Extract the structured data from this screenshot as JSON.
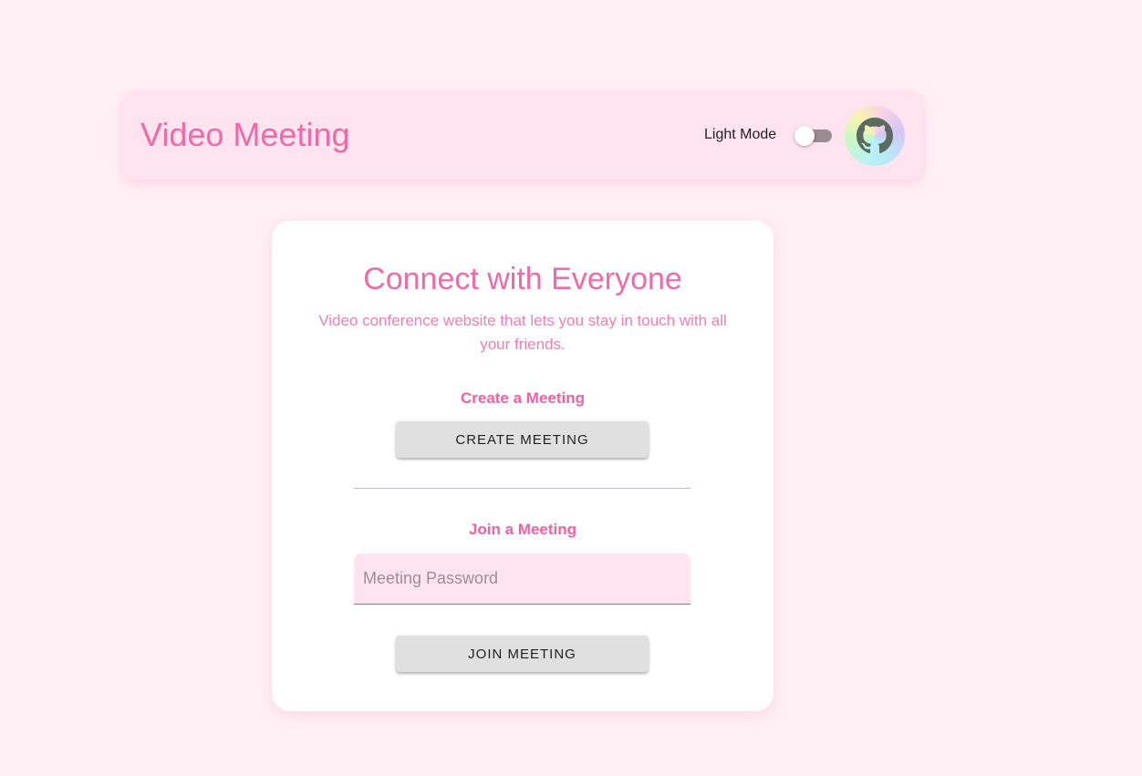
{
  "header": {
    "title": "Video Meeting",
    "mode_label": "Light Mode",
    "dark_mode_enabled": false,
    "github_icon": "github-icon"
  },
  "card": {
    "title": "Connect with Everyone",
    "subtitle": "Video conference website that lets you stay in touch with all your friends.",
    "create_heading": "Create a Meeting",
    "create_button": "CREATE MEETING",
    "join_heading": "Join a Meeting",
    "password_placeholder": "Meeting Password",
    "password_value": "",
    "join_button": "JOIN MEETING"
  },
  "colors": {
    "page_bg": "#fff0f5",
    "header_bg": "#ffe4ef",
    "accent": "#f06aa8",
    "button_bg": "#e0e0e0",
    "card_bg": "#ffffff"
  }
}
